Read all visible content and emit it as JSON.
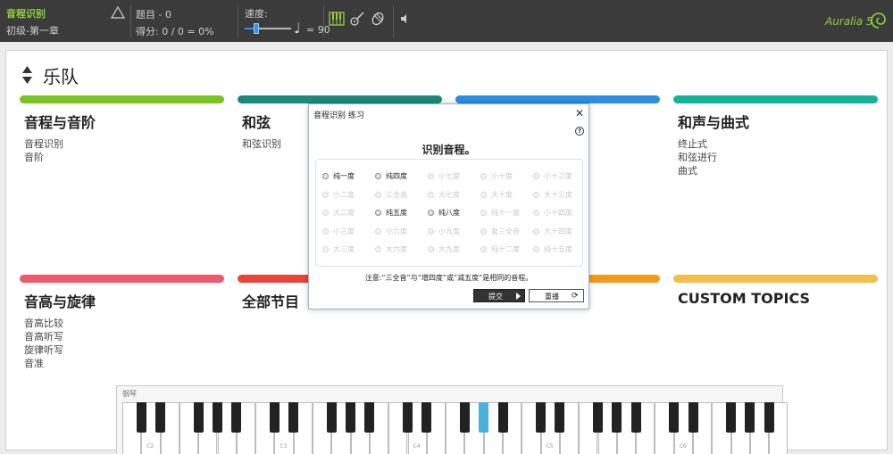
{
  "topbar": {
    "mode_title": "音程识别",
    "level": "初级-第一章",
    "question_label": "题目 - 0",
    "score_label": "得分: 0 / 0 = 0%",
    "speed_label": "速度:",
    "speed_value": "= 90",
    "speed_fraction": 0.2,
    "logo": "Auralia 5",
    "icons": [
      "triangle-up-icon",
      "piano-icon",
      "guitar-icon",
      "tambourine-icon",
      "speaker-icon"
    ],
    "accent_color": "#8fd13f"
  },
  "band": {
    "title": "乐队"
  },
  "cards": [
    {
      "title": "音程与音阶",
      "color": "#7ac41f",
      "items": [
        "音程识别",
        "音阶"
      ]
    },
    {
      "title": "和弦",
      "color": "#1a8a7a",
      "items": [
        "和弦识别"
      ]
    },
    {
      "title": "",
      "color": "#2b8fe6",
      "items": []
    },
    {
      "title": "和声与曲式",
      "color": "#13b39a",
      "items": [
        "终止式",
        "和弦进行",
        "曲式"
      ]
    },
    {
      "title": "音高与旋律",
      "color": "#ef5a6a",
      "items": [
        "音高比较",
        "音高听写",
        "旋律听写",
        "音准"
      ]
    },
    {
      "title": "全部节目",
      "color": "#e6473a",
      "items": []
    },
    {
      "title": "",
      "color": "#f39a1a",
      "items": []
    },
    {
      "title": "CUSTOM TOPICS",
      "color": "#f2c04a",
      "items": []
    }
  ],
  "piano": {
    "label": "钢琴",
    "octave_labels": [
      "C2",
      "C3",
      "C4",
      "C5",
      "C6",
      "C7"
    ],
    "highlight_color": "#4ab2d8"
  },
  "dialog": {
    "title": "音程识别 练习",
    "close": "✕",
    "help": "?",
    "heading": "识别音程。",
    "options": [
      [
        "纯一度",
        "纯四度",
        "小七度",
        "小十度",
        "小十三度"
      ],
      [
        "小二度",
        "三全音",
        "大七度",
        "大十度",
        "大十三度"
      ],
      [
        "大二度",
        "纯五度",
        "纯八度",
        "纯十一度",
        "小十四度"
      ],
      [
        "小三度",
        "小六度",
        "小九度",
        "复三全音",
        "大十四度"
      ],
      [
        "大三度",
        "大六度",
        "大九度",
        "纯十二度",
        "纯十五度"
      ]
    ],
    "enabled": [
      "纯一度",
      "纯四度",
      "纯五度",
      "纯八度"
    ],
    "note": "注意:“三全音”与“增四度”或“减五度”是相同的音程。",
    "submit_label": "提交",
    "replay_label": "重播",
    "replay_icon": "⟳"
  }
}
